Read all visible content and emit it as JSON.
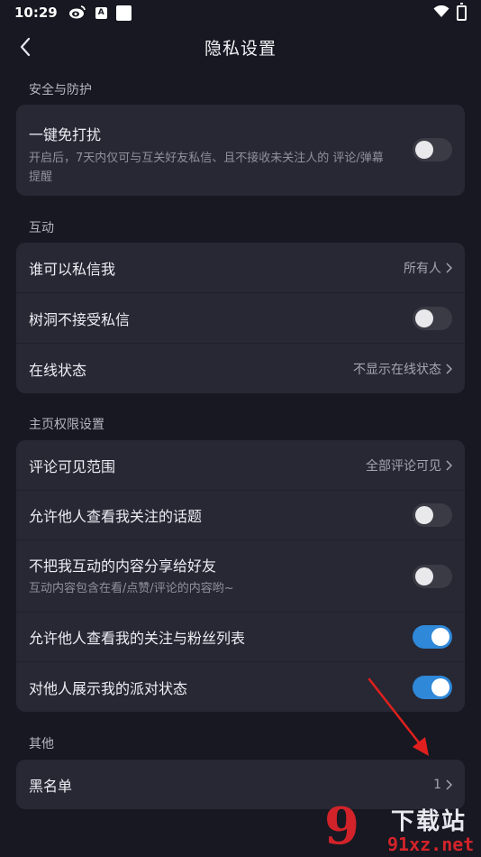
{
  "status_bar": {
    "time": "10:29",
    "badge_letter": "A"
  },
  "header": {
    "title": "隐私设置"
  },
  "sections": {
    "security": {
      "label": "安全与防护",
      "dnd": {
        "title": "一键免打扰",
        "subtitle": "开启后，7天内仅可与互关好友私信、且不接收未关注人的 评论/弹幕 提醒",
        "toggle": "off"
      }
    },
    "interaction": {
      "label": "互动",
      "who_can_message": {
        "title": "谁可以私信我",
        "value": "所有人"
      },
      "treehole": {
        "title": "树洞不接受私信",
        "toggle": "off"
      },
      "online_status": {
        "title": "在线状态",
        "value": "不显示在线状态"
      }
    },
    "homepage": {
      "label": "主页权限设置",
      "comment_scope": {
        "title": "评论可见范围",
        "value": "全部评论可见"
      },
      "view_topics": {
        "title": "允许他人查看我关注的话题",
        "toggle": "off"
      },
      "no_share": {
        "title": "不把我互动的内容分享给好友",
        "subtitle": "互动内容包含在看/点赞/评论的内容哟~",
        "toggle": "off"
      },
      "view_follows": {
        "title": "允许他人查看我的关注与粉丝列表",
        "toggle": "on"
      },
      "party_status": {
        "title": "对他人展示我的派对状态",
        "toggle": "on"
      }
    },
    "other": {
      "label": "其他",
      "blacklist": {
        "title": "黑名单",
        "value": "1"
      }
    }
  },
  "watermark": {
    "logo": "9",
    "top": "下载站",
    "bottom": "91xz.net"
  },
  "colors": {
    "background": "#171821",
    "card": "#272833",
    "toggle_on": "#2f88d8",
    "annotation_arrow": "#e0201e",
    "watermark_red": "#d2232a"
  }
}
